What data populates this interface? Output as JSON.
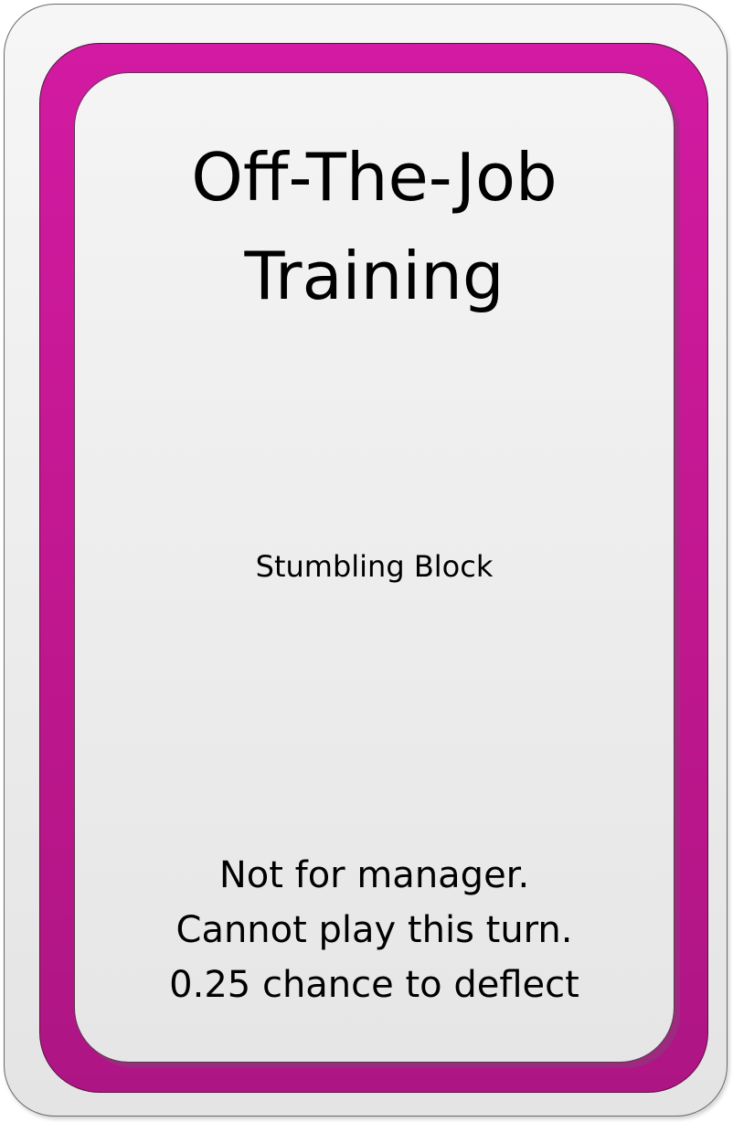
{
  "card": {
    "title_lines": [
      "Off-The-Job",
      "Training"
    ],
    "type": "Stumbling Block",
    "rules": [
      "Not for manager.",
      "Cannot play this turn.",
      "0.25 chance to deflect"
    ],
    "colors": {
      "frame": "#c8189a",
      "face": "#eeeeee",
      "outer": "#f0f0f0",
      "text": "#000000"
    }
  }
}
